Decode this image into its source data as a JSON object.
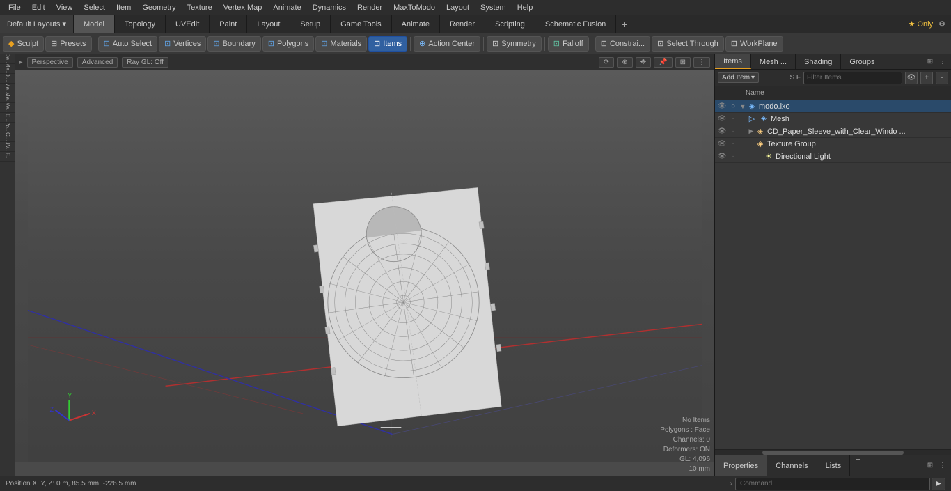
{
  "menu": {
    "items": [
      "File",
      "Edit",
      "View",
      "Select",
      "Item",
      "Geometry",
      "Texture",
      "Vertex Map",
      "Animate",
      "Dynamics",
      "Render",
      "MaxToModo",
      "Layout",
      "System",
      "Help"
    ]
  },
  "layout_bar": {
    "dropdown": "Default Layouts ▾",
    "tabs": [
      "Model",
      "Topology",
      "UVEdit",
      "Paint",
      "Layout",
      "Setup",
      "Game Tools",
      "Animate",
      "Render",
      "Scripting",
      "Schematic Fusion"
    ],
    "active_tab": "Model",
    "plus": "+",
    "star_only": "★ Only",
    "settings_icon": "⚙"
  },
  "toolbar": {
    "sculpt": "Sculpt",
    "presets": "Presets",
    "auto_select": "Auto Select",
    "vertices": "Vertices",
    "boundary": "Boundary",
    "polygons": "Polygons",
    "materials": "Materials",
    "items": "Items",
    "action_center": "Action Center",
    "symmetry": "Symmetry",
    "falloff": "Falloff",
    "constraints": "Constrai...",
    "select_through": "Select Through",
    "workplane": "WorkPlane"
  },
  "viewport": {
    "view_type": "Perspective",
    "mode": "Advanced",
    "ray_gl": "Ray GL: Off",
    "orbit_icon": "⟳",
    "zoom_icon": "⊕",
    "pan_icon": "✥",
    "toggle_icon": "⊟",
    "expand_icon": "⊞"
  },
  "viewport_status": {
    "no_items": "No Items",
    "polygons": "Polygons : Face",
    "channels": "Channels: 0",
    "deformers": "Deformers: ON",
    "gl": "GL: 4,096",
    "mm": "10 mm"
  },
  "right_panel": {
    "tabs": [
      "Items",
      "Mesh ...",
      "Shading",
      "Groups"
    ],
    "active_tab": "Items",
    "toolbar": {
      "add_item": "Add Item",
      "add_item_arrow": "▾",
      "filter_placeholder": "Filter Items",
      "filter_label": "S F",
      "btn_eye": "👁",
      "btn_plus": "+",
      "btn_minus": "-"
    },
    "list_header": {
      "name": "Name"
    },
    "items": [
      {
        "id": 1,
        "indent": 0,
        "has_arrow": true,
        "arrow_open": true,
        "icon": "mesh",
        "name": "modo.lxo",
        "eye": true,
        "children": [
          {
            "id": 2,
            "indent": 1,
            "has_arrow": false,
            "icon": "mesh",
            "name": "Mesh",
            "eye": true
          },
          {
            "id": 3,
            "indent": 1,
            "has_arrow": true,
            "arrow_open": false,
            "icon": "group",
            "name": "CD_Paper_Sleeve_with_Clear_Windo ...",
            "eye": true
          },
          {
            "id": 4,
            "indent": 1,
            "has_arrow": false,
            "icon": "group",
            "name": "Texture Group",
            "eye": true
          },
          {
            "id": 5,
            "indent": 2,
            "has_arrow": false,
            "icon": "light",
            "name": "Directional Light",
            "eye": true
          }
        ]
      }
    ]
  },
  "properties_panel": {
    "tabs": [
      "Properties",
      "Channels",
      "Lists"
    ],
    "active_tab": "Properties",
    "plus": "+"
  },
  "status_bar": {
    "position": "Position X, Y, Z:  0 m, 85.5 mm, -226.5 mm",
    "command_placeholder": "Command",
    "execute_icon": "▶"
  },
  "left_sidebar": {
    "tools": [
      "De...",
      "Me...",
      "Du...",
      "Me...",
      "Me...",
      "Ve...",
      "E...",
      "Po...",
      "C...",
      "UV...",
      "F..."
    ]
  }
}
